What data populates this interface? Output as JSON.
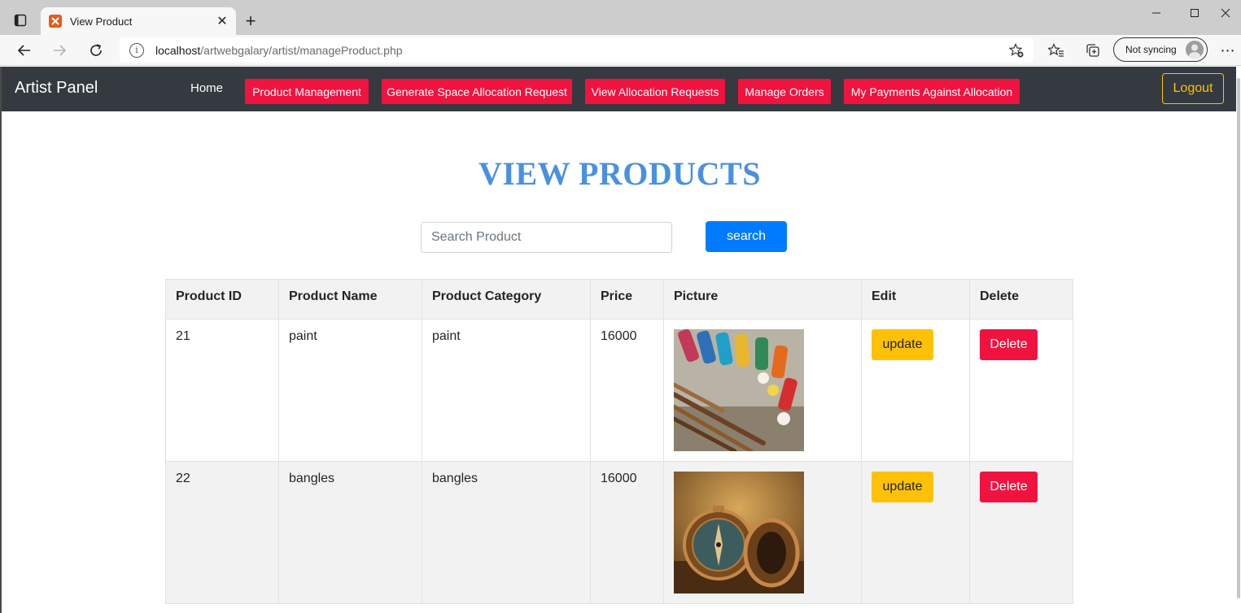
{
  "browser": {
    "tab_title": "View Product",
    "url_host": "localhost",
    "url_path": "/artwebgalary/artist/manageProduct.php",
    "profile_label": "Not syncing"
  },
  "navbar": {
    "brand": "Artist Panel",
    "home": "Home",
    "links": [
      "Product Management",
      "Generate Space Allocation Request",
      "View Allocation Requests",
      "Manage Orders",
      "My Payments Against Allocation"
    ],
    "logout": "Logout"
  },
  "page": {
    "heading": "VIEW PRODUCTS",
    "search_placeholder": "Search Product",
    "search_button": "search"
  },
  "table": {
    "headers": [
      "Product ID",
      "Product Name",
      "Product Category",
      "Price",
      "Picture",
      "Edit",
      "Delete"
    ],
    "rows": [
      {
        "id": "21",
        "name": "paint",
        "category": "paint",
        "price": "16000",
        "picture": "paint-tubes-and-brushes-image",
        "edit": "update",
        "delete": "Delete"
      },
      {
        "id": "22",
        "name": "bangles",
        "category": "bangles",
        "price": "16000",
        "picture": "antique-compass-image",
        "edit": "update",
        "delete": "Delete"
      }
    ]
  },
  "colors": {
    "navbar_bg": "#343a40",
    "nav_button_red": "#f0133f",
    "logout_yellow": "#ffc107",
    "heading_blue": "#4a90e2",
    "search_blue": "#007bff",
    "update_yellow": "#ffc107",
    "delete_red": "#f0133f"
  }
}
